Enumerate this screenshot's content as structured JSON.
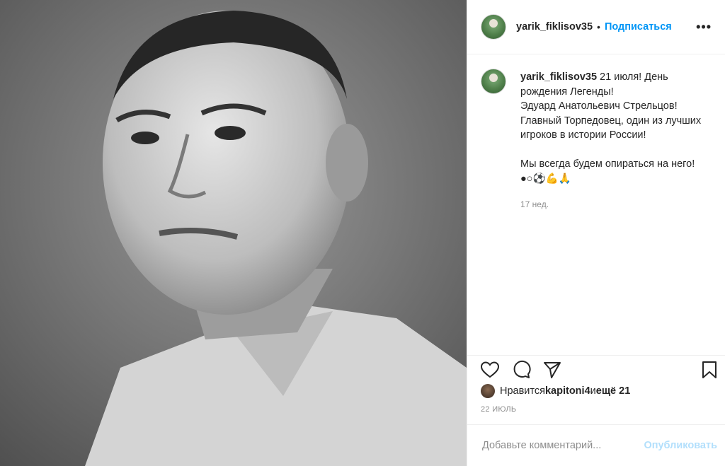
{
  "post_image": {
    "description_icon": "portrait-photo"
  },
  "header": {
    "username": "yarik_fiklisov35",
    "separator": "•",
    "follow_label": "Подписаться",
    "more_label": "•••"
  },
  "caption": {
    "username": "yarik_fiklisov35",
    "text": " 21 июля! День рождения Легенды!\nЭдуард Анатольевич Стрельцов!\nГлавный Торпедовец, один из лучших игроков в истории России!\n\nМы всегда будем опираться на него!\n●○⚽💪🙏",
    "time": "17 нед."
  },
  "actions": {
    "like_icon": "heart-icon",
    "comment_icon": "comment-icon",
    "share_icon": "share-icon",
    "save_icon": "bookmark-icon"
  },
  "likes": {
    "prefix": "Нравится ",
    "user": "kapitoni4",
    "middle": " и ",
    "count_text": "ещё 21"
  },
  "date": "22 ИЮЛЬ",
  "comment": {
    "placeholder": "Добавьте комментарий...",
    "publish_label": "Опубликовать"
  }
}
